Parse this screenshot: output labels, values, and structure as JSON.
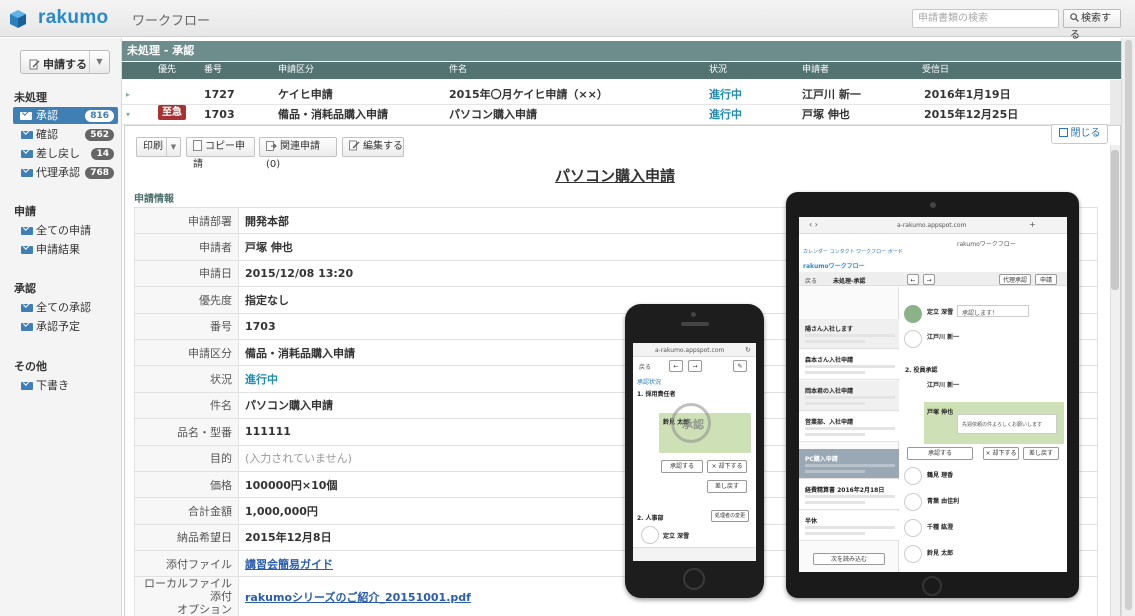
{
  "app": {
    "brand": "rakumo",
    "module": "ワークフロー"
  },
  "search": {
    "placeholder": "申請書類の検索",
    "button_label": "検索する"
  },
  "sidebar": {
    "new_button": "申請する",
    "sections": [
      {
        "title": "未処理",
        "items": [
          {
            "label": "承認",
            "count": "816",
            "active": true
          },
          {
            "label": "確認",
            "count": "562"
          },
          {
            "label": "差し戻し",
            "count": "14"
          },
          {
            "label": "代理承認",
            "count": "768"
          }
        ]
      },
      {
        "title": "申請",
        "items": [
          {
            "label": "全ての申請"
          },
          {
            "label": "申請結果"
          }
        ]
      },
      {
        "title": "承認",
        "items": [
          {
            "label": "全ての承認"
          },
          {
            "label": "承認予定"
          }
        ]
      },
      {
        "title": "その他",
        "items": [
          {
            "label": "下書き"
          }
        ]
      }
    ]
  },
  "list": {
    "section_title": "未処理 - 承認",
    "columns": [
      "優先",
      "番号",
      "申請区分",
      "件名",
      "状況",
      "申請者",
      "受信日"
    ],
    "rows": [
      {
        "priority": "",
        "number": "1727",
        "category": "ケイヒ申請",
        "subject": "2015年〇月ケイヒ申請（××）",
        "status": "進行中",
        "applicant": "江戸川 新一",
        "received": "2016年1月19日"
      },
      {
        "priority": "至急",
        "number": "1703",
        "category": "備品・消耗品購入申請",
        "subject": "パソコン購入申請",
        "status": "進行中",
        "applicant": "戸塚 伸也",
        "received": "2015年12月25日"
      }
    ]
  },
  "detail": {
    "close_label": "閉じる",
    "toolbar": {
      "print": "印刷",
      "copy": "コピー申請",
      "related": "関連申請 (0)",
      "edit": "編集する"
    },
    "title": "パソコン購入申請",
    "info_label": "申請情報",
    "fields": [
      {
        "label": "申請部署",
        "value": "開発本部"
      },
      {
        "label": "申請者",
        "value": "戸塚 伸也"
      },
      {
        "label": "申請日",
        "value": "2015/12/08 13:20"
      },
      {
        "label": "優先度",
        "value": "指定なし"
      },
      {
        "label": "番号",
        "value": "1703"
      },
      {
        "label": "申請区分",
        "value": "備品・消耗品購入申請"
      },
      {
        "label": "状況",
        "value": "進行中"
      },
      {
        "label": "件名",
        "value": "パソコン購入申請"
      },
      {
        "label": "品名・型番",
        "value": "111111"
      },
      {
        "label": "目的",
        "value": "(入力されていません)"
      },
      {
        "label": "価格",
        "value": "100000円×10個"
      },
      {
        "label": "合計金額",
        "value": "1,000,000円"
      },
      {
        "label": "納品希望日",
        "value": "2015年12月8日"
      },
      {
        "label": "添付ファイル",
        "value": "講習会簡易ガイド"
      },
      {
        "label": "ローカルファイル添付オプション",
        "label_lines": [
          "ローカルファイル添付",
          "オプション"
        ],
        "value": "rakumoシリーズのご紹介_20151001.pdf"
      }
    ]
  },
  "phone": {
    "url": "a-rakumo.appspot.com",
    "back": "戻る",
    "section": "承認状況",
    "step1": "1. 採用責任者",
    "approver1": "鈴見 太郎",
    "approve": "承認する",
    "reject": "× 却下する",
    "send_back": "差し戻す",
    "step2": "2. 人事部",
    "approver2": "定立 深雪",
    "change": "処理者の変更",
    "stamp": "承認"
  },
  "tablet": {
    "url": "a-rakumo.appspot.com",
    "module": "rakumoワークフロー",
    "nav": "カレンダー  コンタクト  ワークフロー  ボード",
    "back": "戻る",
    "list_title": "未処理-承認",
    "proxy": "代理承認",
    "apply": "申請",
    "items": [
      "陽さん入社します",
      "森本さん入社申請",
      "岡本君の入社申請",
      "営業部、入社申請",
      "PC購入申請",
      "経費精算書 2016年2月18日",
      "半休"
    ],
    "more": "次を読み込む",
    "approver_a": "定立 深雪",
    "comment": "承認します！",
    "approver_b": "江戸川 新一",
    "step2": "2. 役員承認",
    "approver_c": "江戸川 新一",
    "approver_d": "戸塚 伸也",
    "comment2": "先週依頼の件よろしくお願いします",
    "approve": "承認する",
    "reject": "× 却下する",
    "send_back": "差し戻す",
    "approver_e": "鶴見 理香",
    "approver_f": "青葉 由佳利",
    "approver_g": "千種 紘澄",
    "approver_h": "鈴見 太郎"
  }
}
